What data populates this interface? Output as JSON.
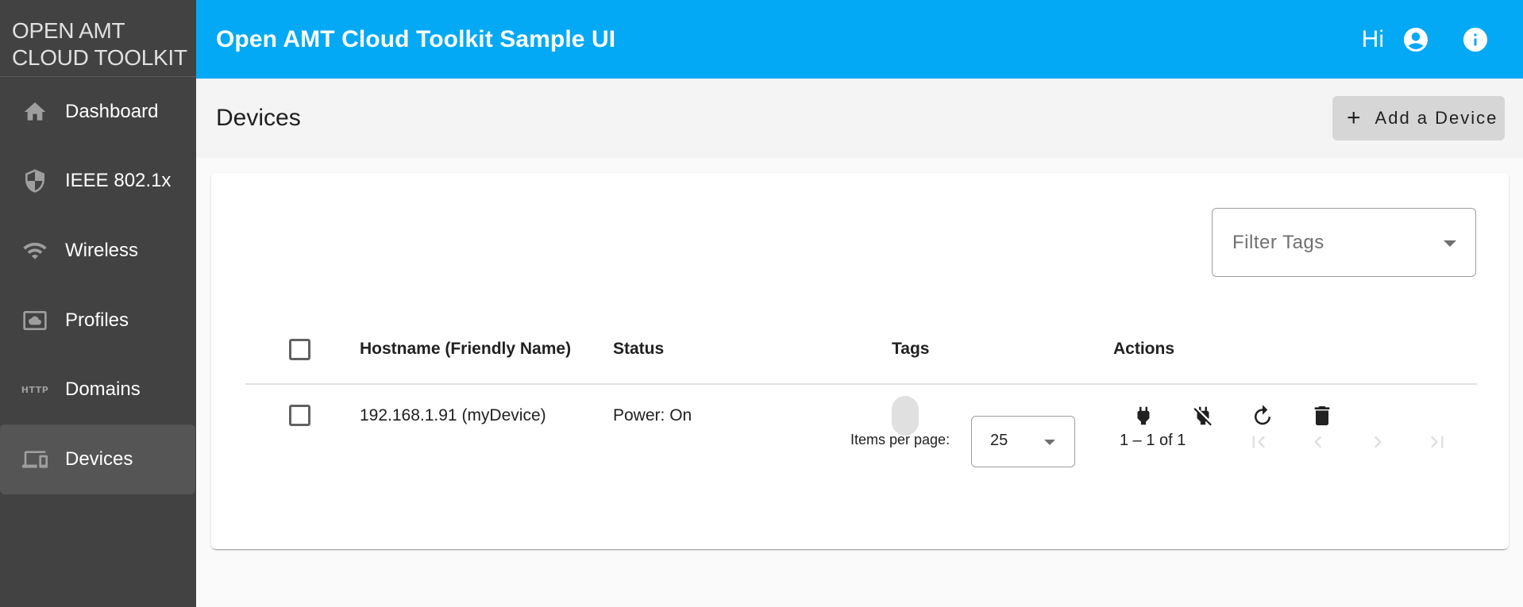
{
  "brand": {
    "line1": "OPEN AMT",
    "line2": "CLOUD TOOLKIT"
  },
  "sidebar": {
    "items": [
      {
        "label": "Dashboard",
        "icon": "home-icon",
        "active": false
      },
      {
        "label": "IEEE 802.1x",
        "icon": "shield-icon",
        "active": false
      },
      {
        "label": "Wireless",
        "icon": "wifi-icon",
        "active": false
      },
      {
        "label": "Profiles",
        "icon": "cloud-profile-icon",
        "active": false
      },
      {
        "label": "Domains",
        "icon": "http-icon",
        "active": false
      },
      {
        "label": "Devices",
        "icon": "devices-icon",
        "active": true
      }
    ],
    "http_glyph": "HTTP"
  },
  "header": {
    "title": "Open AMT Cloud Toolkit Sample UI",
    "greeting": "Hi",
    "account_icon": "account-circle-icon",
    "info_icon": "info-icon"
  },
  "page": {
    "title": "Devices",
    "add_button": {
      "icon": "+",
      "label": "Add a Device"
    }
  },
  "filter": {
    "placeholder": "Filter Tags"
  },
  "table": {
    "columns": [
      "Hostname (Friendly Name)",
      "Status",
      "Tags",
      "Actions"
    ],
    "rows": [
      {
        "hostname": "192.168.1.91 (myDevice)",
        "status": "Power: On",
        "tags": [
          ""
        ],
        "actions": [
          "power-on-icon",
          "power-off-icon",
          "reset-icon",
          "delete-icon"
        ]
      }
    ]
  },
  "paginator": {
    "items_per_page_label": "Items per page:",
    "items_per_page": "25",
    "range_label": "1 – 1 of 1"
  },
  "colors": {
    "primary": "#03a9f4",
    "sidebar": "#424242",
    "sidebar_active": "#555555",
    "add_button": "#d6d6d6"
  }
}
